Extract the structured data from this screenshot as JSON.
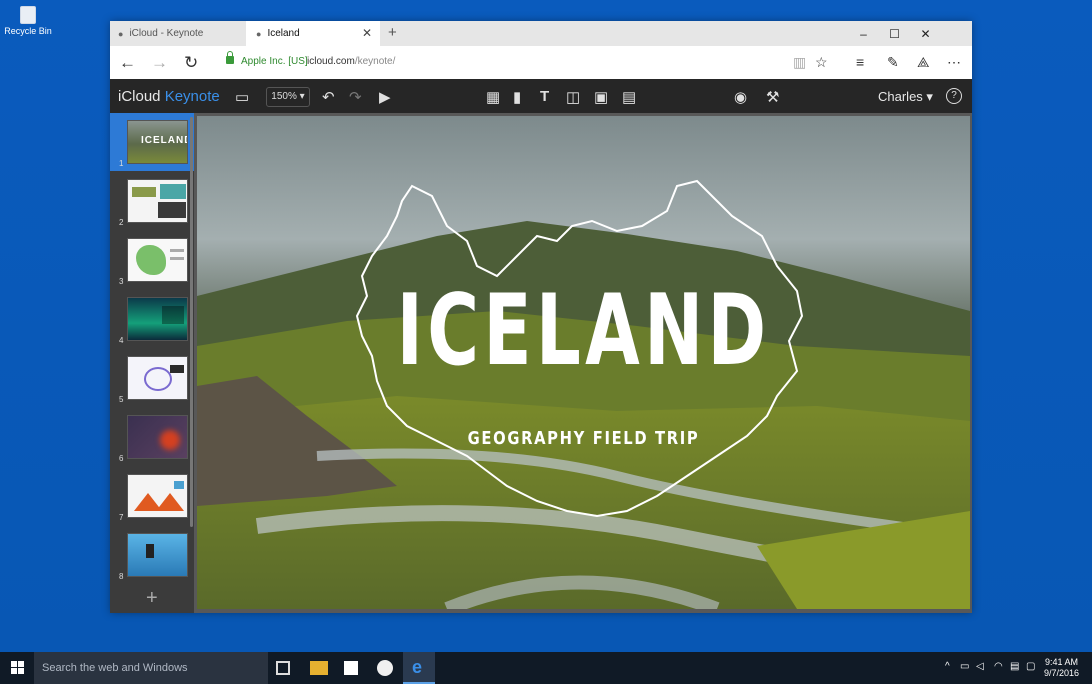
{
  "desktop": {
    "recycle_bin_label": "Recycle Bin"
  },
  "browser": {
    "tabs": [
      {
        "label": "iCloud - Keynote",
        "active": false
      },
      {
        "label": "Iceland",
        "active": true
      }
    ],
    "new_tab": "+",
    "window_controls": {
      "minimize": "–",
      "maximize": "☐",
      "close": "✕"
    },
    "address": {
      "site_identity": "Apple Inc. [US]",
      "url_host": "icloud.com",
      "url_path": "/keynote/"
    }
  },
  "keynote": {
    "brand_icloud": "iCloud",
    "brand_app": "Keynote",
    "zoom": "150%",
    "user": "Charles",
    "help": "?",
    "slides": [
      {
        "number": "1"
      },
      {
        "number": "2"
      },
      {
        "number": "3"
      },
      {
        "number": "4"
      },
      {
        "number": "5"
      },
      {
        "number": "6"
      },
      {
        "number": "7"
      },
      {
        "number": "8"
      }
    ],
    "add_slide": "+",
    "current_slide": {
      "title": "ICELAND",
      "subtitle": "GEOGRAPHY FIELD TRIP"
    }
  },
  "taskbar": {
    "search_placeholder": "Search the web and Windows",
    "time": "9:41 AM",
    "date": "9/7/2016"
  },
  "colors": {
    "accent": "#2d7ad6",
    "keynote_blue": "#3a8fe8",
    "toolbar": "#262626"
  }
}
